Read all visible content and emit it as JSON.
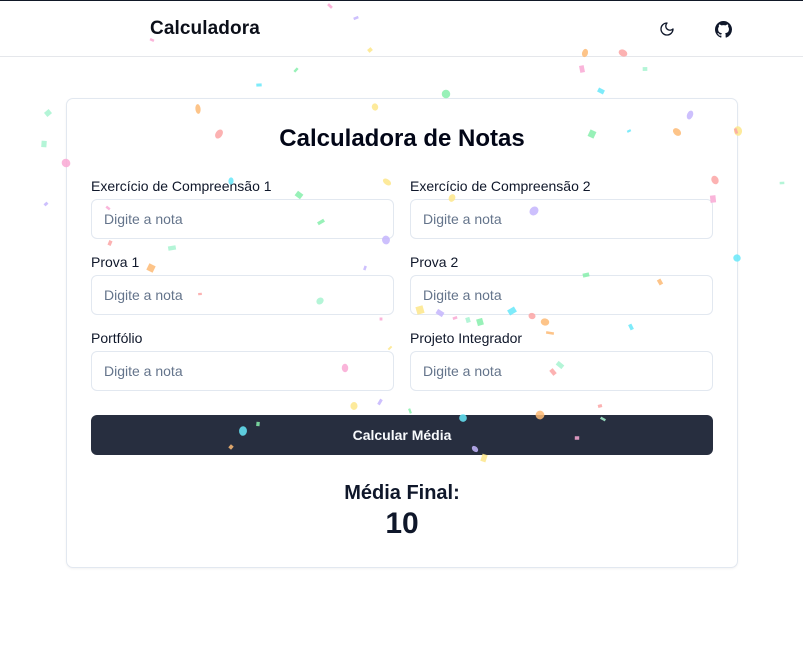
{
  "header": {
    "title": "Calculadora",
    "theme_icon": "moon-icon",
    "repo_icon": "github-icon"
  },
  "card": {
    "title": "Calculadora de Notas",
    "fields": [
      {
        "label": "Exercício de Compreensão 1",
        "placeholder": "Digite a nota",
        "value": ""
      },
      {
        "label": "Exercício de Compreensão 2",
        "placeholder": "Digite a nota",
        "value": ""
      },
      {
        "label": "Prova 1",
        "placeholder": "Digite a nota",
        "value": ""
      },
      {
        "label": "Prova 2",
        "placeholder": "Digite a nota",
        "value": ""
      },
      {
        "label": "Portfólio",
        "placeholder": "Digite a nota",
        "value": ""
      },
      {
        "label": "Projeto Integrador",
        "placeholder": "Digite a nota",
        "value": ""
      }
    ],
    "button_label": "Calcular Média",
    "result_label": "Média Final:",
    "result_value": "10"
  },
  "colors": {
    "button_bg": "#272e3f",
    "button_text": "#f8fafc",
    "border": "#e2e8f0",
    "confetti": [
      "#f9a8d4",
      "#c4b5fd",
      "#fde68a",
      "#86efac",
      "#67e8f9",
      "#fdba74",
      "#fca5a5",
      "#a7f3d0"
    ]
  }
}
